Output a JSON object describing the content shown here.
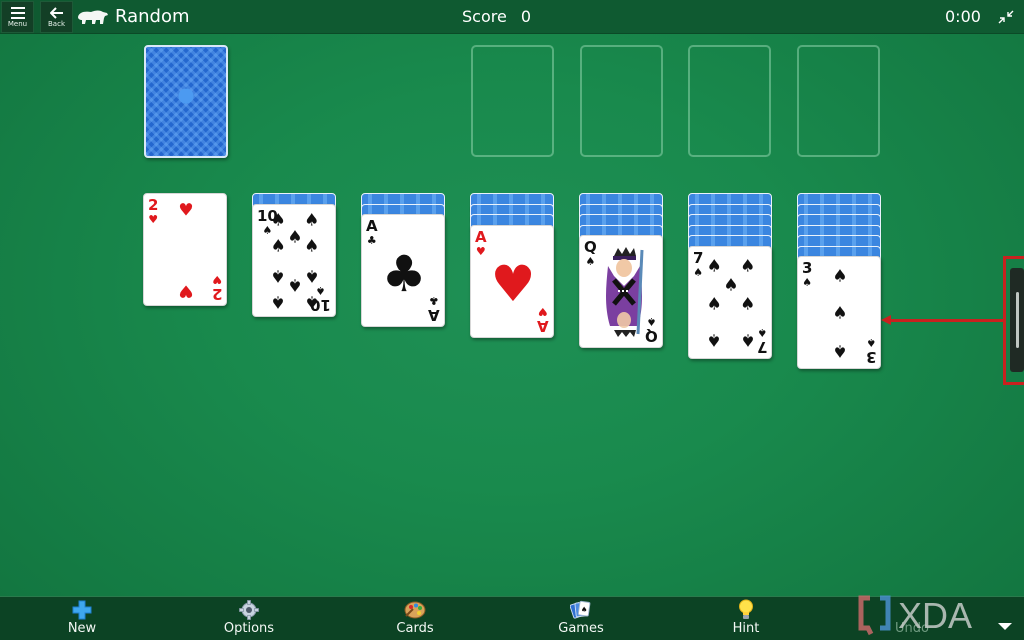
{
  "topbar": {
    "menu_label": "Menu",
    "back_label": "Back",
    "game_title": "Random",
    "score_label": "Score",
    "score_value": "0",
    "timer": "0:00",
    "icons": {
      "menu": "hamburger-icon",
      "back": "arrow-left-icon",
      "logo": "polar-bear-icon",
      "restore": "exit-fullscreen-icon"
    }
  },
  "stock": {
    "face_down": true
  },
  "foundations": [
    {
      "empty": true
    },
    {
      "empty": true
    },
    {
      "empty": true
    },
    {
      "empty": true
    }
  ],
  "tableau": [
    {
      "face_down_count": 0,
      "top": {
        "rank": "2",
        "suit": "hearts",
        "symbol": "♥",
        "color": "red"
      }
    },
    {
      "face_down_count": 1,
      "top": {
        "rank": "10",
        "suit": "spades",
        "symbol": "♠",
        "color": "black"
      }
    },
    {
      "face_down_count": 2,
      "top": {
        "rank": "A",
        "suit": "clubs",
        "symbol": "♣",
        "color": "black"
      }
    },
    {
      "face_down_count": 3,
      "top": {
        "rank": "A",
        "suit": "hearts",
        "symbol": "♥",
        "color": "red"
      }
    },
    {
      "face_down_count": 4,
      "top": {
        "rank": "Q",
        "suit": "spades",
        "symbol": "♠",
        "color": "black"
      }
    },
    {
      "face_down_count": 5,
      "top": {
        "rank": "7",
        "suit": "spades",
        "symbol": "♠",
        "color": "black"
      }
    },
    {
      "face_down_count": 6,
      "top": {
        "rank": "3",
        "suit": "spades",
        "symbol": "♠",
        "color": "black"
      }
    }
  ],
  "bottombar": {
    "items": [
      {
        "label": "New",
        "icon": "plus-icon",
        "enabled": true
      },
      {
        "label": "Options",
        "icon": "gear-icon",
        "enabled": true
      },
      {
        "label": "Cards",
        "icon": "palette-icon",
        "enabled": true
      },
      {
        "label": "Games",
        "icon": "card-fan-icon",
        "enabled": true
      },
      {
        "label": "Hint",
        "icon": "lightbulb-icon",
        "enabled": true
      },
      {
        "label": "Undo",
        "icon": "undo-icon",
        "enabled": false
      }
    ]
  },
  "watermark": {
    "text": "XDA"
  },
  "colors": {
    "felt": "#198a4d",
    "topbar": "#0f5a31",
    "bottombar": "#0c4324",
    "card_back": "#2467cf",
    "red_suit": "#e0191d",
    "annotation": "#c9211f"
  }
}
